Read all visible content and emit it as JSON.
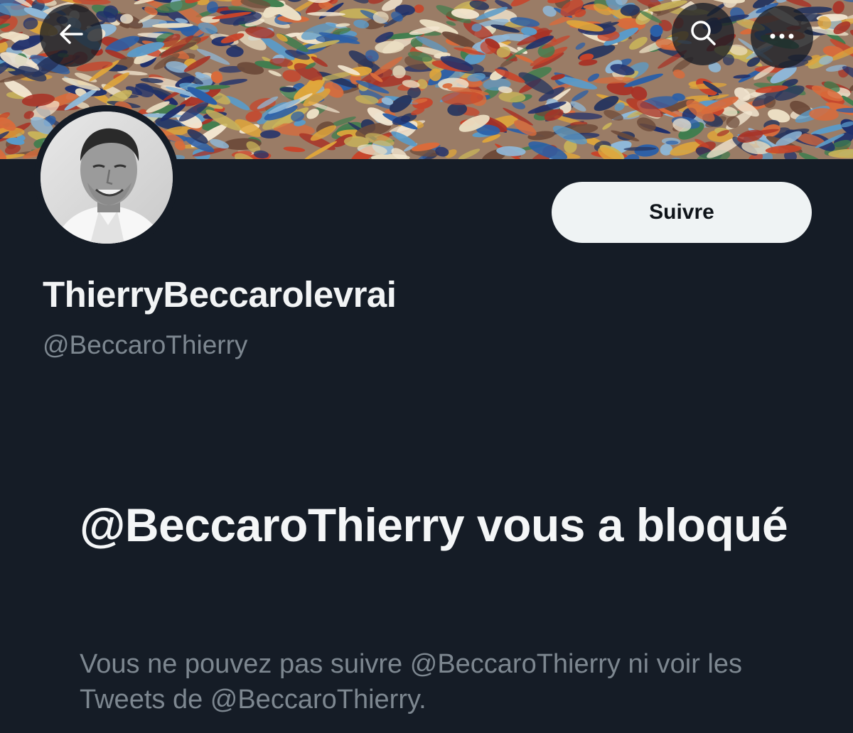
{
  "header": {
    "back_icon": "arrow-left-icon",
    "search_icon": "search-icon",
    "more_icon": "more-horizontal-icon"
  },
  "profile": {
    "display_name": "ThierryBeccarolevrai",
    "handle": "@BeccaroThierry",
    "follow_label": "Suivre"
  },
  "blocked_notice": {
    "title": "@BeccaroThierry vous a bloqué",
    "description": "Vous ne pouvez pas suivre @BeccaroThierry ni voir les Tweets de @BeccaroThierry."
  },
  "colors": {
    "background": "#151c26",
    "text_primary": "#f4f6f7",
    "text_secondary": "#7d8790",
    "button_bg": "#eff3f4"
  }
}
